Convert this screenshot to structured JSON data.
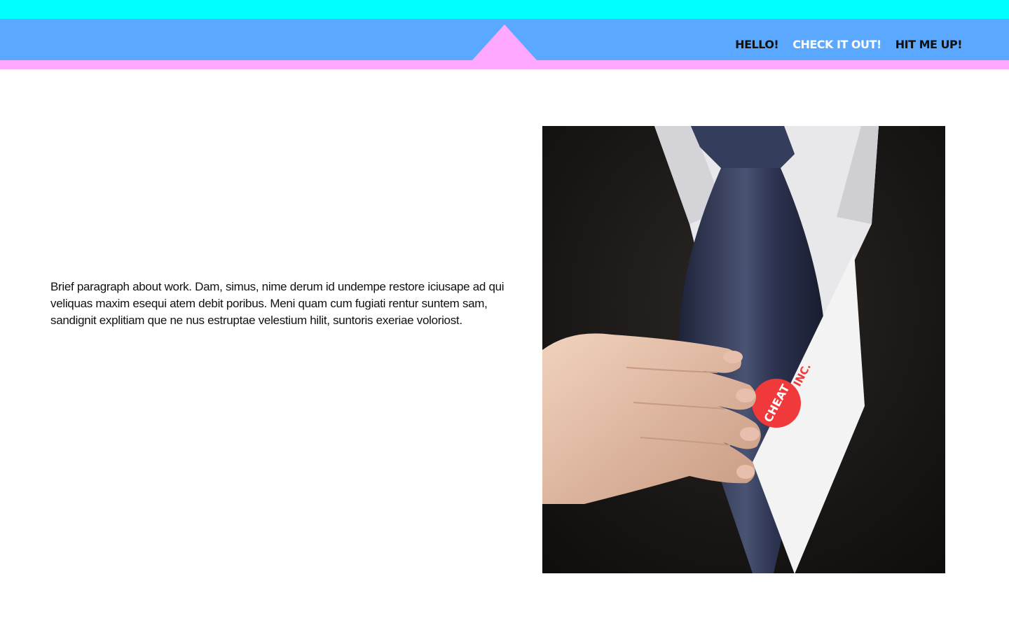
{
  "colors": {
    "top_strip": "#00ffff",
    "nav_bar": "#5aa8ff",
    "accent_pink": "#ffa8ff",
    "nav_active": "#111111",
    "nav_inactive": "#ffffff",
    "text": "#111111"
  },
  "nav": {
    "items": [
      {
        "label": "HELLO!",
        "active": true
      },
      {
        "label": "CHECK IT OUT!",
        "active": false
      },
      {
        "label": "HIT ME UP!",
        "active": true
      }
    ]
  },
  "intro": {
    "text": "Brief paragraph about work. Dam, simus, nime derum id undempe restore iciusape ad qui vel­iquas maxim esequi atem debit poribus. Meni quam cum fugiati rentur suntem sam, sandignit explitiam que ne nus estruptae velestium hilit, suntoris exeriae voloriost."
  },
  "photo": {
    "logo_text": "CHEAT INC."
  }
}
